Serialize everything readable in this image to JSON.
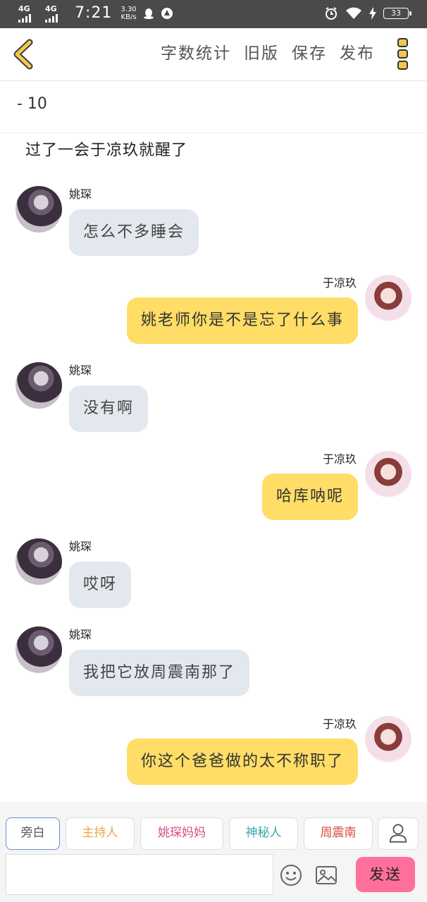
{
  "status": {
    "signal1": "4G",
    "signal2": "4G",
    "time": "7:21",
    "speed_value": "3.30",
    "speed_unit": "KB/s",
    "battery": "33"
  },
  "toolbar": {
    "word_count": "字数统计",
    "old_version": "旧版",
    "save": "保存",
    "publish": "发布"
  },
  "chapter": {
    "title": "- 10"
  },
  "narration": "过了一会于凉玖就醒了",
  "messages": [
    {
      "sender": "姚琛",
      "text": "怎么不多睡会",
      "side": "left"
    },
    {
      "sender": "于凉玖",
      "text": "姚老师你是不是忘了什么事",
      "side": "right"
    },
    {
      "sender": "姚琛",
      "text": "没有啊",
      "side": "left"
    },
    {
      "sender": "于凉玖",
      "text": "哈库呐呢",
      "side": "right"
    },
    {
      "sender": "姚琛",
      "text": "哎呀",
      "side": "left"
    },
    {
      "sender": "姚琛",
      "text": "我把它放周震南那了",
      "side": "left"
    },
    {
      "sender": "于凉玖",
      "text": "你这个爸爸做的太不称职了",
      "side": "right"
    }
  ],
  "roles": [
    {
      "label": "旁白",
      "color": "#555555"
    },
    {
      "label": "主持人",
      "color": "#f0a24a"
    },
    {
      "label": "姚琛妈妈",
      "color": "#d64c8a"
    },
    {
      "label": "神秘人",
      "color": "#3aa6b0"
    },
    {
      "label": "周震南",
      "color": "#d94a3a"
    }
  ],
  "input": {
    "placeholder": ""
  },
  "send_label": "发送",
  "colors": {
    "accent_yellow": "#ffdd66",
    "left_bubble": "#e3e8ee",
    "send_button": "#ff6f9c",
    "back_icon": "#f2c94c"
  }
}
